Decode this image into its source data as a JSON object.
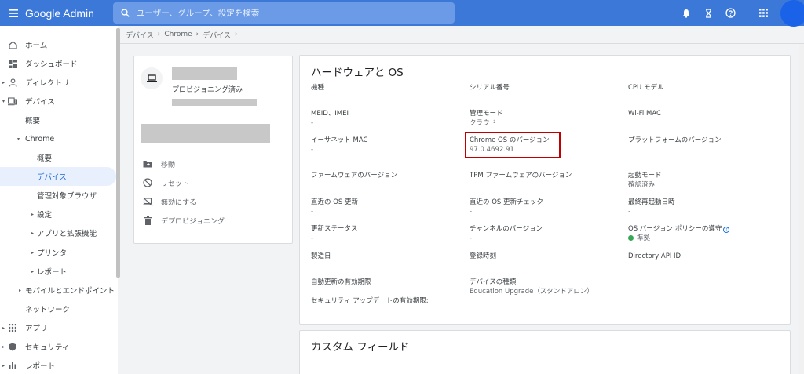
{
  "topbar": {
    "brand": "Google Admin",
    "search_placeholder": "ユーザー、グループ、設定を検索",
    "icons": [
      "menu-icon",
      "search-icon",
      "bell-icon",
      "hourglass-icon",
      "help-icon",
      "apps-icon"
    ]
  },
  "sidebar": {
    "items": [
      {
        "label": "ホーム",
        "icon": "home-icon"
      },
      {
        "label": "ダッシュボード",
        "icon": "dashboard-icon"
      },
      {
        "label": "ディレクトリ",
        "icon": "person-icon"
      },
      {
        "label": "デバイス",
        "icon": "devices-icon"
      },
      {
        "label": "概要"
      },
      {
        "label": "Chrome"
      },
      {
        "label": "概要"
      },
      {
        "label": "デバイス"
      },
      {
        "label": "管理対象ブラウザ"
      },
      {
        "label": "設定"
      },
      {
        "label": "アプリと拡張機能"
      },
      {
        "label": "プリンタ"
      },
      {
        "label": "レポート"
      },
      {
        "label": "モバイルとエンドポイント"
      },
      {
        "label": "ネットワーク"
      },
      {
        "label": "アプリ",
        "icon": "apps-grid-icon"
      },
      {
        "label": "セキュリティ",
        "icon": "shield-icon"
      },
      {
        "label": "レポート",
        "icon": "bar-chart-icon"
      }
    ]
  },
  "breadcrumb": [
    "デバイス",
    "Chrome",
    "デバイス",
    ""
  ],
  "device_card": {
    "status": "プロビジョニング済み",
    "actions": [
      {
        "label": "移動",
        "icon": "move-folder-icon"
      },
      {
        "label": "リセット",
        "icon": "reset-icon"
      },
      {
        "label": "無効にする",
        "icon": "disable-icon"
      },
      {
        "label": "デプロビジョニング",
        "icon": "trash-icon"
      }
    ]
  },
  "hardware": {
    "title": "ハードウェアと OS",
    "fields": {
      "model": {
        "label": "機種",
        "value": ""
      },
      "serial": {
        "label": "シリアル番号",
        "value": ""
      },
      "cpu": {
        "label": "CPU モデル",
        "value": ""
      },
      "meid": {
        "label": "MEID、IMEI",
        "value": "-"
      },
      "mode": {
        "label": "管理モード",
        "value": "クラウド"
      },
      "wifi": {
        "label": "Wi-Fi MAC",
        "value": ""
      },
      "ethernet": {
        "label": "イーサネット MAC",
        "value": "-"
      },
      "chromeos": {
        "label": "Chrome OS のバージョン",
        "value": "97.0.4692.91"
      },
      "platform": {
        "label": "プラットフォームのバージョン",
        "value": ""
      },
      "firmware": {
        "label": "ファームウェアのバージョン",
        "value": ""
      },
      "tpm": {
        "label": "TPM ファームウェアのバージョン",
        "value": ""
      },
      "boot": {
        "label": "起動モード",
        "value": "確認済み"
      },
      "os_update": {
        "label": "直近の OS 更新",
        "value": "-"
      },
      "update_check": {
        "label": "直近の OS 更新チェック",
        "value": "-"
      },
      "reboot": {
        "label": "最終再起動日時",
        "value": "-"
      },
      "update_status": {
        "label": "更新ステータス",
        "value": "-"
      },
      "channel": {
        "label": "チャンネルのバージョン",
        "value": "-"
      },
      "compliance": {
        "label": "OS バージョン ポリシーの遵守",
        "value": "準拠"
      },
      "manufacture": {
        "label": "製造日",
        "value": ""
      },
      "registration": {
        "label": "登録時刻",
        "value": ""
      },
      "directory_api": {
        "label": "Directory API ID",
        "value": ""
      },
      "auto_update": {
        "label": "自動更新の有効期限",
        "value": ""
      },
      "device_type": {
        "label": "デバイスの種類",
        "value": "Education Upgrade（スタンドアロン）"
      },
      "security_update": {
        "label": "セキュリティ アップデートの有効期限:",
        "value": ""
      }
    }
  },
  "custom_fields": {
    "title": "カスタム フィールド"
  },
  "colors": {
    "topbar": "#3c78d8",
    "active": "#1967d2",
    "highlight_box": "#c00000",
    "compliant_dot": "#34a853"
  }
}
